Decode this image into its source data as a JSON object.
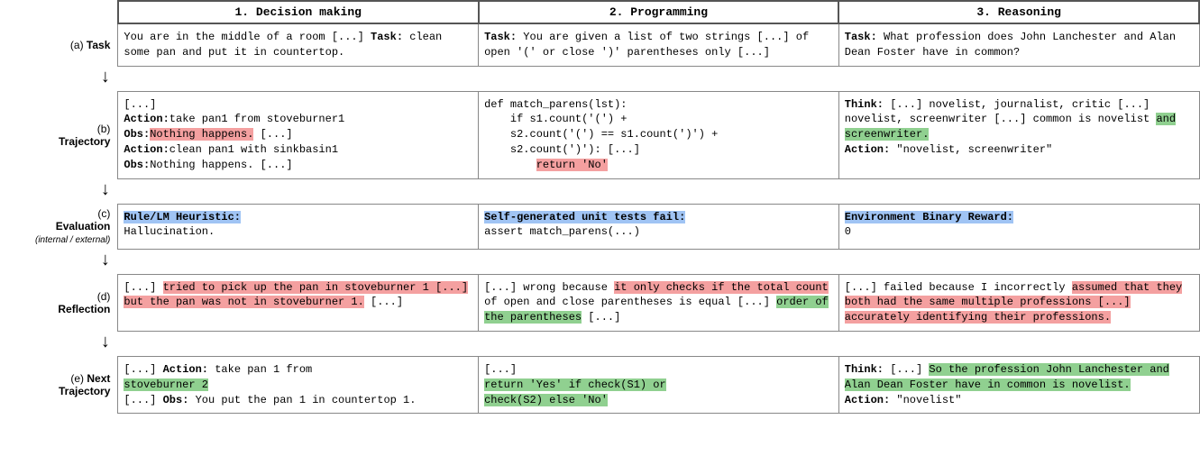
{
  "headers": {
    "col1": "1. Decision making",
    "col2": "2. Programming",
    "col3": "3. Reasoning"
  },
  "rows": {
    "task": {
      "label": "(a) Task",
      "col1": {
        "segments": [
          {
            "text": "You are in the middle of a room [...] ",
            "bold": false
          },
          {
            "text": "Task:",
            "bold": true
          },
          {
            "text": " clean some pan and put it in countertop.",
            "bold": false
          }
        ]
      },
      "col2": {
        "segments": [
          {
            "text": "Task:",
            "bold": true
          },
          {
            "text": " You are given a list of two strings [...] of open '(' or close ')' parentheses only [...]",
            "bold": false
          }
        ]
      },
      "col3": {
        "segments": [
          {
            "text": "Task:",
            "bold": true
          },
          {
            "text": " What profession does John Lanchester and Alan Dean Foster have in common?",
            "bold": false
          }
        ]
      }
    },
    "trajectory": {
      "label": "Trajectory",
      "label_prefix": "(b)",
      "col1": {
        "lines": [
          {
            "text": "[...]",
            "bold": false
          },
          {
            "text": "Action:",
            "bold": true,
            "suffix": "take pan1 from stoveburner1"
          },
          {
            "text": "Obs:",
            "bold": true,
            "suffix_highlight": "Nothing happens.",
            "suffix_rest": " [...]"
          },
          {
            "text": "Action:",
            "bold": true,
            "suffix": "clean pan1 with sinkbasin1"
          },
          {
            "text": "Obs:",
            "bold": false,
            "suffix": "Nothing happens. [...]"
          }
        ]
      },
      "col2": {
        "code": "def match_parens(lst):\n    if s1.count('(') +\n    s2.count('(') == s1.count(')') +\n    s2.count(')'): [...]\n        return 'No'",
        "highlight_line": "return 'No'"
      },
      "col3": {
        "segments": [
          {
            "text": "Think:",
            "bold": true
          },
          {
            "text": " [...] novelist, journalist, critic [...] novelist, screenwriter [...] common is novelist ",
            "bold": false
          },
          {
            "text": "and screenwriter.",
            "bold": false,
            "highlight": "green"
          },
          {
            "text": "\nAction:",
            "bold": true
          },
          {
            "text": " \"novelist, screenwriter\"",
            "bold": false
          }
        ]
      }
    },
    "evaluation": {
      "label": "Evaluation",
      "label_prefix": "(c)",
      "sub_label": "(internal / external)",
      "col1": {
        "title": "Rule/LM Heuristic:",
        "title_highlight": true,
        "body": "Hallucination."
      },
      "col2": {
        "title": "Self-generated unit tests fail:",
        "title_highlight": true,
        "body": "assert match_parens(...)"
      },
      "col3": {
        "title": "Environment Binary Reward:",
        "title_highlight": true,
        "body": "0"
      }
    },
    "reflection": {
      "label": "Reflection",
      "label_prefix": "(d)",
      "col1": {
        "segments": [
          {
            "text": "[...] ",
            "bold": false
          },
          {
            "text": "tried to pick up the pan in stoveburner 1 [...] but the pan was not in stoveburner 1.",
            "highlight": "pink"
          },
          {
            "text": " [...]",
            "bold": false
          }
        ]
      },
      "col2": {
        "segments": [
          {
            "text": "[...] wrong because ",
            "bold": false
          },
          {
            "text": "it only checks if the total count",
            "highlight": "pink"
          },
          {
            "text": " of open and close parentheses is equal [...] ",
            "bold": false
          },
          {
            "text": "order of the parentheses",
            "highlight": "green"
          },
          {
            "text": " [...]",
            "bold": false
          }
        ]
      },
      "col3": {
        "segments": [
          {
            "text": "[...] failed because I incorrectly ",
            "bold": false
          },
          {
            "text": "assumed that they both had the same multiple professions [...] accurately identifying their professions.",
            "highlight": "pink"
          }
        ]
      }
    },
    "next_trajectory": {
      "label": "Next\nTrajectory",
      "label_prefix": "(e)",
      "col1": {
        "segments": [
          {
            "text": "[...] ",
            "bold": false
          },
          {
            "text": "Action:",
            "bold": true
          },
          {
            "text": " take pan 1 from\n",
            "bold": false
          },
          {
            "text": "stoveburner 2",
            "highlight": "green"
          },
          {
            "text": "\n[...] ",
            "bold": false
          },
          {
            "text": "Obs:",
            "bold": true
          },
          {
            "text": " You put the pan 1 in countertop 1.",
            "bold": false
          }
        ]
      },
      "col2": {
        "segments": [
          {
            "text": "[...]\n",
            "bold": false
          },
          {
            "text": "    return 'Yes' if check(S1) or\n    check(S2) else 'No'",
            "highlight": "green"
          }
        ]
      },
      "col3": {
        "segments": [
          {
            "text": "Think:",
            "bold": true
          },
          {
            "text": " [...] ",
            "bold": false
          },
          {
            "text": "So the profession John Lanchester and Alan Dean Foster have in common is novelist.",
            "highlight": "green"
          },
          {
            "text": "\nAction:",
            "bold": true
          },
          {
            "text": " \"novelist\"",
            "bold": false
          }
        ]
      }
    }
  }
}
